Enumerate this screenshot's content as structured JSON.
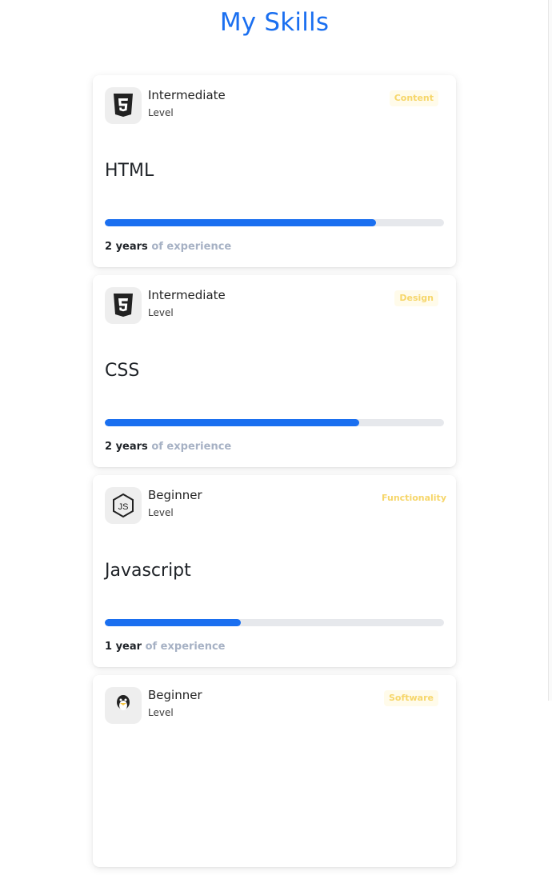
{
  "header": {
    "title": "My Skills"
  },
  "skills": [
    {
      "name": "HTML",
      "level": "Intermediate",
      "level_label": "Level",
      "category": "Content",
      "years": "2 years",
      "experience_suffix": " of experience",
      "progress": 0.8,
      "icon": "html5-icon"
    },
    {
      "name": "CSS",
      "level": "Intermediate",
      "level_label": "Level",
      "category": "Design",
      "years": "2 years",
      "experience_suffix": " of experience",
      "progress": 0.75,
      "icon": "css3-icon"
    },
    {
      "name": "Javascript",
      "level": "Beginner",
      "level_label": "Level",
      "category": "Functionality",
      "years": "1 year",
      "experience_suffix": " of experience",
      "progress": 0.4,
      "icon": "nodejs-icon"
    },
    {
      "name": "",
      "level": "Beginner",
      "level_label": "Level",
      "category": "Software",
      "years": "",
      "experience_suffix": "",
      "progress": 0,
      "icon": "linux-tux-icon"
    }
  ],
  "colors": {
    "accent": "#1a6ff0",
    "badge_text": "#f6d66a",
    "badge_bg": "#fffbea",
    "muted": "#a6b1c4"
  }
}
